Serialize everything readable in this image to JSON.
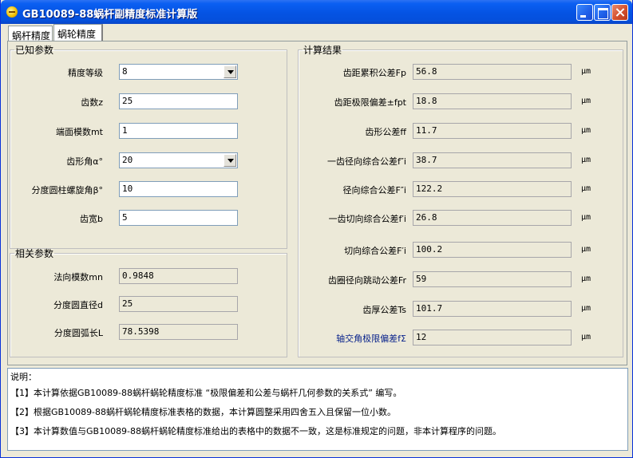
{
  "window": {
    "title": "GB10089-88蜗杆副精度标准计算版"
  },
  "tabs": [
    "蜗杆精度",
    "蜗轮精度"
  ],
  "known": {
    "legend": "已知参数",
    "fields": [
      {
        "label": "精度等级",
        "value": "8",
        "type": "combo"
      },
      {
        "label": "齿数z",
        "value": "25",
        "type": "text"
      },
      {
        "label": "端面模数mt",
        "value": "1",
        "type": "text"
      },
      {
        "label": "齿形角α°",
        "value": "20",
        "type": "combo"
      },
      {
        "label": "分度圆柱螺旋角β°",
        "value": "10",
        "type": "text"
      },
      {
        "label": "齿宽b",
        "value": "5",
        "type": "text"
      }
    ]
  },
  "related": {
    "legend": "相关参数",
    "fields": [
      {
        "label": "法向模数mn",
        "value": "0.9848"
      },
      {
        "label": "分度圆直径d",
        "value": "25"
      },
      {
        "label": "分度圆弧长L",
        "value": "78.5398"
      }
    ]
  },
  "results": {
    "legend": "计算结果",
    "unit": "μm",
    "fields": [
      {
        "label": "齿距累积公差Fp",
        "value": "56.8"
      },
      {
        "label": "齿距极限偏差±fpt",
        "value": "18.8"
      },
      {
        "label": "齿形公差ff",
        "value": "11.7"
      },
      {
        "label": "一齿径向综合公差f″i",
        "value": "38.7"
      },
      {
        "label": "径向综合公差F″i",
        "value": "122.2"
      },
      {
        "label": "一齿切向综合公差f′i",
        "value": "26.8"
      },
      {
        "label": "切向综合公差F′i",
        "value": "100.2"
      },
      {
        "label": "齿圈径向跳动公差Fr",
        "value": "59"
      },
      {
        "label": "齿厚公差Ts",
        "value": "101.7"
      },
      {
        "label": "轴交角极限偏差fΣ",
        "value": "12"
      }
    ]
  },
  "notes": {
    "title": "说明：",
    "lines": [
      "【1】本计算依据GB10089-88蜗杆蜗轮精度标准 “极限偏差和公差与蜗杆几何参数的关系式” 编写。",
      "【2】根据GB10089-88蜗杆蜗轮精度标准表格的数据，本计算圆整采用四舍五入且保留一位小数。",
      "【3】本计算数值与GB10089-88蜗杆蜗轮精度标准给出的表格中的数据不一致，这是标准规定的问题，非本计算程序的问题。"
    ]
  }
}
